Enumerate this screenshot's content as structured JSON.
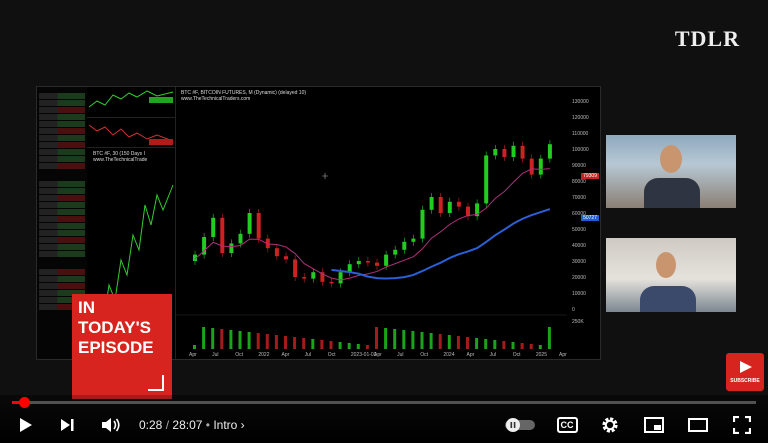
{
  "brand": {
    "logo": "TDLR"
  },
  "chart": {
    "title": "BTC #F, BITCOIN FUTURES, M (Dynamic) (delayed 10)",
    "subtitle": "www.TheTechnicalTraders.com",
    "mini_title": "BTC #F, 30 (150 Days I",
    "mini_subtitle": "www.TheTechnicalTrade",
    "price_tags": [
      "79309",
      "50727"
    ],
    "axis_labels": [
      "130000",
      "120000",
      "110000",
      "100000",
      "90000",
      "80000",
      "70000",
      "60000",
      "50000",
      "40000",
      "30000",
      "20000",
      "10000",
      "0"
    ],
    "x_labels": [
      "Apr",
      "Jul",
      "Oct",
      "2022",
      "Apr",
      "Jul",
      "Oct",
      "2023-01-01",
      "Apr",
      "Jul",
      "Oct",
      "2024",
      "Apr",
      "Jul",
      "Oct",
      "2025",
      "Apr"
    ],
    "volume_label": "250K"
  },
  "promo": {
    "text": "IN\nTODAY'S\nEPISODE"
  },
  "subscribe": {
    "label": "SUBSCRIBE"
  },
  "player": {
    "current_time": "0:28",
    "separator": "/",
    "duration": "28:07",
    "chapter_bullet": "•",
    "chapter": "Intro",
    "progress_fraction": 0.0166,
    "cc_label": "CC"
  },
  "colors": {
    "accent": "#ff0000",
    "promo": "#d8241f",
    "candle_up": "#22cc22",
    "candle_down": "#cc2222"
  }
}
